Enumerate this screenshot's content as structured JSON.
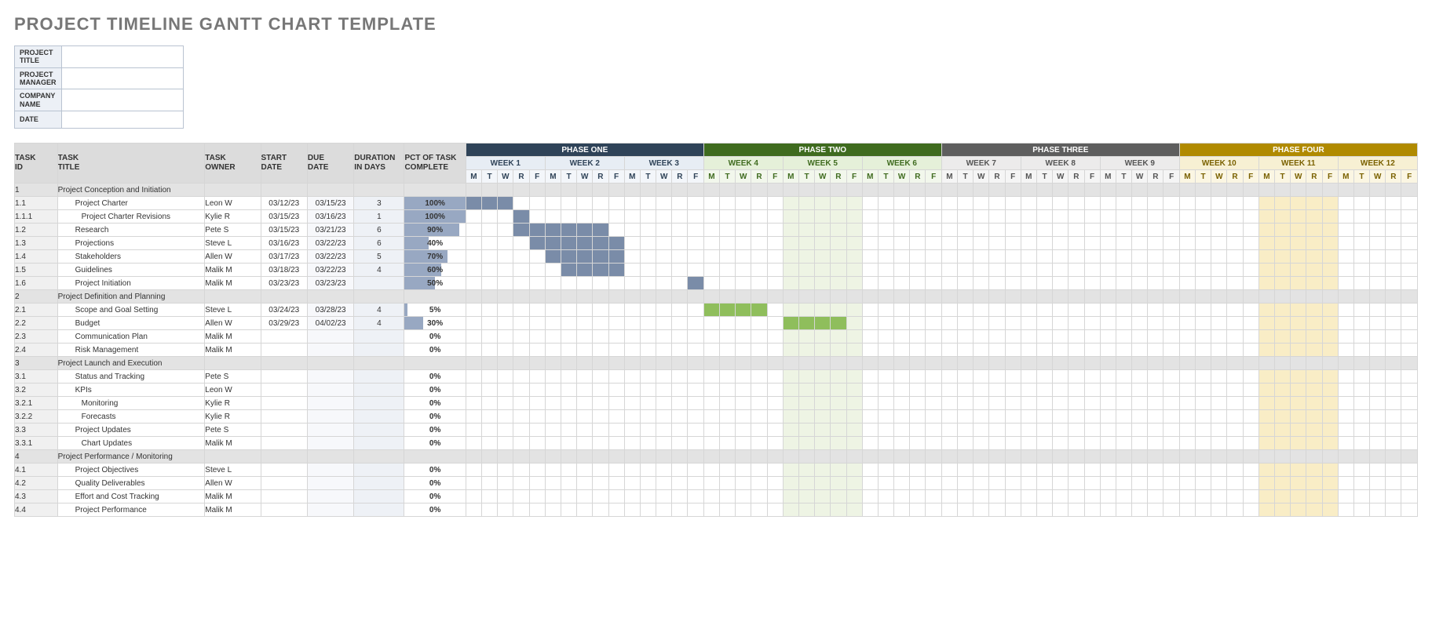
{
  "title": "PROJECT TIMELINE GANTT CHART TEMPLATE",
  "meta_labels": [
    "PROJECT TITLE",
    "PROJECT MANAGER",
    "COMPANY NAME",
    "DATE"
  ],
  "columns": {
    "task_id": "TASK ID",
    "task_title": "TASK TITLE",
    "task_owner": "TASK OWNER",
    "start_date": "START DATE",
    "due_date": "DUE DATE",
    "duration": "DURATION IN DAYS",
    "pct": "PCT OF TASK COMPLETE"
  },
  "phases": [
    {
      "label": "PHASE ONE",
      "cls": "phase1",
      "weeks": [
        {
          "label": "WEEK 1"
        },
        {
          "label": "WEEK 2"
        },
        {
          "label": "WEEK 3"
        }
      ]
    },
    {
      "label": "PHASE TWO",
      "cls": "phase2",
      "weeks": [
        {
          "label": "WEEK 4"
        },
        {
          "label": "WEEK 5",
          "hl": true
        },
        {
          "label": "WEEK 6"
        }
      ]
    },
    {
      "label": "PHASE THREE",
      "cls": "phase3",
      "weeks": [
        {
          "label": "WEEK 7"
        },
        {
          "label": "WEEK 8"
        },
        {
          "label": "WEEK 9"
        }
      ]
    },
    {
      "label": "PHASE FOUR",
      "cls": "phase4",
      "weeks": [
        {
          "label": "WEEK 10"
        },
        {
          "label": "WEEK 11",
          "hl": true
        },
        {
          "label": "WEEK 12"
        }
      ]
    }
  ],
  "days": [
    "M",
    "T",
    "W",
    "R",
    "F"
  ],
  "rows": [
    {
      "section": true,
      "id": "1",
      "title": "Project Conception and Initiation"
    },
    {
      "id": "1.1",
      "title": "Project Charter",
      "ind": 1,
      "owner": "Leon W",
      "start": "03/12/23",
      "due": "03/15/23",
      "dur": "3",
      "pct": "100%",
      "bar": 100,
      "fill": [
        0,
        3
      ],
      "fillcls": "fill1"
    },
    {
      "id": "1.1.1",
      "title": "Project Charter Revisions",
      "ind": 2,
      "owner": "Kylie R",
      "start": "03/15/23",
      "due": "03/16/23",
      "dur": "1",
      "pct": "100%",
      "bar": 100,
      "fill": [
        3,
        4
      ],
      "fillcls": "fill1"
    },
    {
      "id": "1.2",
      "title": "Research",
      "ind": 1,
      "owner": "Pete S",
      "start": "03/15/23",
      "due": "03/21/23",
      "dur": "6",
      "pct": "90%",
      "bar": 90,
      "fill": [
        3,
        9
      ],
      "fillcls": "fill1"
    },
    {
      "id": "1.3",
      "title": "Projections",
      "ind": 1,
      "owner": "Steve L",
      "start": "03/16/23",
      "due": "03/22/23",
      "dur": "6",
      "pct": "40%",
      "bar": 40,
      "fill": [
        4,
        10
      ],
      "fillcls": "fill1"
    },
    {
      "id": "1.4",
      "title": "Stakeholders",
      "ind": 1,
      "owner": "Allen W",
      "start": "03/17/23",
      "due": "03/22/23",
      "dur": "5",
      "pct": "70%",
      "bar": 70,
      "fill": [
        5,
        10
      ],
      "fillcls": "fill1"
    },
    {
      "id": "1.5",
      "title": "Guidelines",
      "ind": 1,
      "owner": "Malik M",
      "start": "03/18/23",
      "due": "03/22/23",
      "dur": "4",
      "pct": "60%",
      "bar": 60,
      "fill": [
        6,
        10
      ],
      "fillcls": "fill1"
    },
    {
      "id": "1.6",
      "title": "Project Initiation",
      "ind": 1,
      "owner": "Malik M",
      "start": "03/23/23",
      "due": "03/23/23",
      "dur": "",
      "pct": "50%",
      "bar": 50,
      "fill": [
        14,
        15
      ],
      "fillcls": "fill1"
    },
    {
      "section": true,
      "id": "2",
      "title": "Project Definition and Planning"
    },
    {
      "id": "2.1",
      "title": "Scope and Goal Setting",
      "ind": 1,
      "owner": "Steve L",
      "start": "03/24/23",
      "due": "03/28/23",
      "dur": "4",
      "pct": "5%",
      "bar": 5,
      "fill": [
        15,
        19
      ],
      "fillcls": "fill2"
    },
    {
      "id": "2.2",
      "title": "Budget",
      "ind": 1,
      "owner": "Allen W",
      "start": "03/29/23",
      "due": "04/02/23",
      "dur": "4",
      "pct": "30%",
      "bar": 30,
      "fill": [
        20,
        24
      ],
      "fillcls": "fill2"
    },
    {
      "id": "2.3",
      "title": "Communication Plan",
      "ind": 1,
      "owner": "Malik M",
      "start": "",
      "due": "",
      "dur": "",
      "pct": "0%",
      "bar": 0
    },
    {
      "id": "2.4",
      "title": "Risk Management",
      "ind": 1,
      "owner": "Malik M",
      "start": "",
      "due": "",
      "dur": "",
      "pct": "0%",
      "bar": 0
    },
    {
      "section": true,
      "id": "3",
      "title": "Project Launch and Execution"
    },
    {
      "id": "3.1",
      "title": "Status and Tracking",
      "ind": 1,
      "owner": "Pete S",
      "start": "",
      "due": "",
      "dur": "",
      "pct": "0%",
      "bar": 0
    },
    {
      "id": "3.2",
      "title": "KPIs",
      "ind": 1,
      "owner": "Leon W",
      "start": "",
      "due": "",
      "dur": "",
      "pct": "0%",
      "bar": 0
    },
    {
      "id": "3.2.1",
      "title": "Monitoring",
      "ind": 2,
      "owner": "Kylie R",
      "start": "",
      "due": "",
      "dur": "",
      "pct": "0%",
      "bar": 0
    },
    {
      "id": "3.2.2",
      "title": "Forecasts",
      "ind": 2,
      "owner": "Kylie R",
      "start": "",
      "due": "",
      "dur": "",
      "pct": "0%",
      "bar": 0
    },
    {
      "id": "3.3",
      "title": "Project Updates",
      "ind": 1,
      "owner": "Pete S",
      "start": "",
      "due": "",
      "dur": "",
      "pct": "0%",
      "bar": 0
    },
    {
      "id": "3.3.1",
      "title": "Chart Updates",
      "ind": 2,
      "owner": "Malik M",
      "start": "",
      "due": "",
      "dur": "",
      "pct": "0%",
      "bar": 0
    },
    {
      "section": true,
      "id": "4",
      "title": "Project Performance / Monitoring"
    },
    {
      "id": "4.1",
      "title": "Project Objectives",
      "ind": 1,
      "owner": "Steve L",
      "start": "",
      "due": "",
      "dur": "",
      "pct": "0%",
      "bar": 0
    },
    {
      "id": "4.2",
      "title": "Quality Deliverables",
      "ind": 1,
      "owner": "Allen W",
      "start": "",
      "due": "",
      "dur": "",
      "pct": "0%",
      "bar": 0
    },
    {
      "id": "4.3",
      "title": "Effort and Cost Tracking",
      "ind": 1,
      "owner": "Malik M",
      "start": "",
      "due": "",
      "dur": "",
      "pct": "0%",
      "bar": 0
    },
    {
      "id": "4.4",
      "title": "Project Performance",
      "ind": 1,
      "owner": "Malik M",
      "start": "",
      "due": "",
      "dur": "",
      "pct": "0%",
      "bar": 0
    }
  ],
  "chart_data": {
    "type": "table",
    "title": "Project Timeline Gantt Chart Template",
    "columns": [
      "TASK ID",
      "TASK TITLE",
      "TASK OWNER",
      "START DATE",
      "DUE DATE",
      "DURATION IN DAYS",
      "PCT OF TASK COMPLETE"
    ],
    "phases": [
      "PHASE ONE",
      "PHASE TWO",
      "PHASE THREE",
      "PHASE FOUR"
    ],
    "weeks_per_phase": 3,
    "days_per_week": [
      "M",
      "T",
      "W",
      "R",
      "F"
    ],
    "tasks": [
      {
        "id": "1",
        "title": "Project Conception and Initiation",
        "section": true
      },
      {
        "id": "1.1",
        "title": "Project Charter",
        "owner": "Leon W",
        "start": "03/12/23",
        "due": "03/15/23",
        "duration": 3,
        "pct": 100
      },
      {
        "id": "1.1.1",
        "title": "Project Charter Revisions",
        "owner": "Kylie R",
        "start": "03/15/23",
        "due": "03/16/23",
        "duration": 1,
        "pct": 100
      },
      {
        "id": "1.2",
        "title": "Research",
        "owner": "Pete S",
        "start": "03/15/23",
        "due": "03/21/23",
        "duration": 6,
        "pct": 90
      },
      {
        "id": "1.3",
        "title": "Projections",
        "owner": "Steve L",
        "start": "03/16/23",
        "due": "03/22/23",
        "duration": 6,
        "pct": 40
      },
      {
        "id": "1.4",
        "title": "Stakeholders",
        "owner": "Allen W",
        "start": "03/17/23",
        "due": "03/22/23",
        "duration": 5,
        "pct": 70
      },
      {
        "id": "1.5",
        "title": "Guidelines",
        "owner": "Malik M",
        "start": "03/18/23",
        "due": "03/22/23",
        "duration": 4,
        "pct": 60
      },
      {
        "id": "1.6",
        "title": "Project Initiation",
        "owner": "Malik M",
        "start": "03/23/23",
        "due": "03/23/23",
        "duration": null,
        "pct": 50
      },
      {
        "id": "2",
        "title": "Project Definition and Planning",
        "section": true
      },
      {
        "id": "2.1",
        "title": "Scope and Goal Setting",
        "owner": "Steve L",
        "start": "03/24/23",
        "due": "03/28/23",
        "duration": 4,
        "pct": 5
      },
      {
        "id": "2.2",
        "title": "Budget",
        "owner": "Allen W",
        "start": "03/29/23",
        "due": "04/02/23",
        "duration": 4,
        "pct": 30
      },
      {
        "id": "2.3",
        "title": "Communication Plan",
        "owner": "Malik M",
        "duration": null,
        "pct": 0
      },
      {
        "id": "2.4",
        "title": "Risk Management",
        "owner": "Malik M",
        "duration": null,
        "pct": 0
      },
      {
        "id": "3",
        "title": "Project Launch and Execution",
        "section": true
      },
      {
        "id": "3.1",
        "title": "Status and Tracking",
        "owner": "Pete S",
        "duration": null,
        "pct": 0
      },
      {
        "id": "3.2",
        "title": "KPIs",
        "owner": "Leon W",
        "duration": null,
        "pct": 0
      },
      {
        "id": "3.2.1",
        "title": "Monitoring",
        "owner": "Kylie R",
        "duration": null,
        "pct": 0
      },
      {
        "id": "3.2.2",
        "title": "Forecasts",
        "owner": "Kylie R",
        "duration": null,
        "pct": 0
      },
      {
        "id": "3.3",
        "title": "Project Updates",
        "owner": "Pete S",
        "duration": null,
        "pct": 0
      },
      {
        "id": "3.3.1",
        "title": "Chart Updates",
        "owner": "Malik M",
        "duration": null,
        "pct": 0
      },
      {
        "id": "4",
        "title": "Project Performance / Monitoring",
        "section": true
      },
      {
        "id": "4.1",
        "title": "Project Objectives",
        "owner": "Steve L",
        "duration": null,
        "pct": 0
      },
      {
        "id": "4.2",
        "title": "Quality Deliverables",
        "owner": "Allen W",
        "duration": null,
        "pct": 0
      },
      {
        "id": "4.3",
        "title": "Effort and Cost Tracking",
        "owner": "Malik M",
        "duration": null,
        "pct": 0
      },
      {
        "id": "4.4",
        "title": "Project Performance",
        "owner": "Malik M",
        "duration": null,
        "pct": 0
      }
    ]
  }
}
